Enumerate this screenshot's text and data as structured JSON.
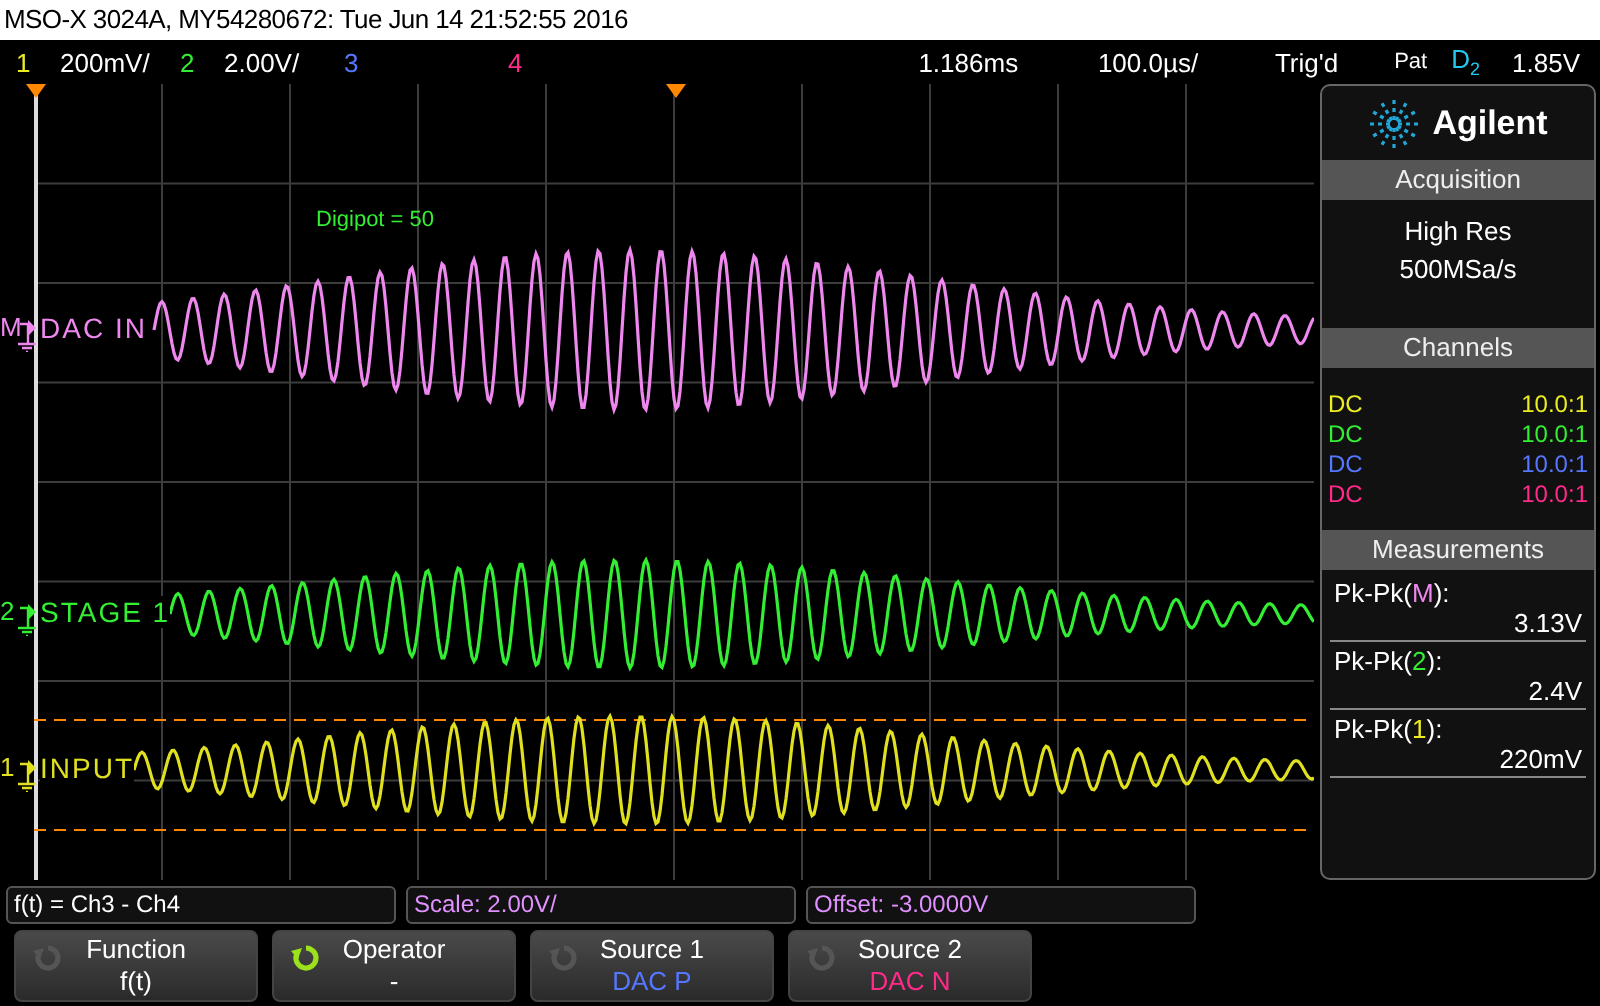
{
  "title_bar": "MSO-X 3024A, MY54280672: Tue Jun 14 21:52:55 2016",
  "channel_scales": [
    {
      "number": "1",
      "scale": "200mV/",
      "color": "#ecec22"
    },
    {
      "number": "2",
      "scale": "2.00V/",
      "color": "#33ee33"
    },
    {
      "number": "3",
      "color": "#5577ff"
    },
    {
      "number": "4",
      "color": "#ff2a8a"
    }
  ],
  "timebase": {
    "delay": "1.186ms",
    "scale": "100.0µs/"
  },
  "trigger": {
    "status": "Trig'd",
    "mode": "Pat",
    "source": "D",
    "source_sub": "2",
    "level": "1.85V"
  },
  "annotation": "Digipot = 50",
  "traces": [
    {
      "marker": "M",
      "label": "DAC IN",
      "color": "#ee88ee"
    },
    {
      "marker": "2",
      "label": "STAGE 1",
      "color": "#33ee33"
    },
    {
      "marker": "1",
      "label": "INPUT",
      "color": "#e0e020"
    }
  ],
  "panel": {
    "brand": "Agilent",
    "acquisition": {
      "title": "Acquisition",
      "lines": [
        "High Res",
        "500MSa/s"
      ]
    },
    "channels": {
      "title": "Channels",
      "rows": [
        {
          "coupling": "DC",
          "probe": "10.0:1",
          "color": "#ecec22"
        },
        {
          "coupling": "DC",
          "probe": "10.0:1",
          "color": "#33ee33"
        },
        {
          "coupling": "DC",
          "probe": "10.0:1",
          "color": "#5577ff"
        },
        {
          "coupling": "DC",
          "probe": "10.0:1",
          "color": "#ff2a8a"
        }
      ]
    },
    "measurements": {
      "title": "Measurements",
      "rows": [
        {
          "name": "Pk-Pk(",
          "source": "M",
          "close": "):",
          "value": "3.13V",
          "color": "#ee88ee"
        },
        {
          "name": "Pk-Pk(",
          "source": "2",
          "close": "):",
          "value": "2.4V",
          "color": "#33ee33"
        },
        {
          "name": "Pk-Pk(",
          "source": "1",
          "close": "):",
          "value": "220mV",
          "color": "#ecec22"
        }
      ]
    }
  },
  "math_info": [
    "f(t) = Ch3 - Ch4",
    "Scale: 2.00V/",
    "Offset: -3.0000V"
  ],
  "softkeys": [
    {
      "label": "Function",
      "value": "f(t)",
      "active": false,
      "color": "#ffffff"
    },
    {
      "label": "Operator",
      "value": "-",
      "active": true,
      "color": "#ffffff"
    },
    {
      "label": "Source 1",
      "value": "DAC P",
      "active": false,
      "color": "#5577ff"
    },
    {
      "label": "Source 2",
      "value": "DAC N",
      "active": false,
      "color": "#ff2a8a"
    }
  ]
}
